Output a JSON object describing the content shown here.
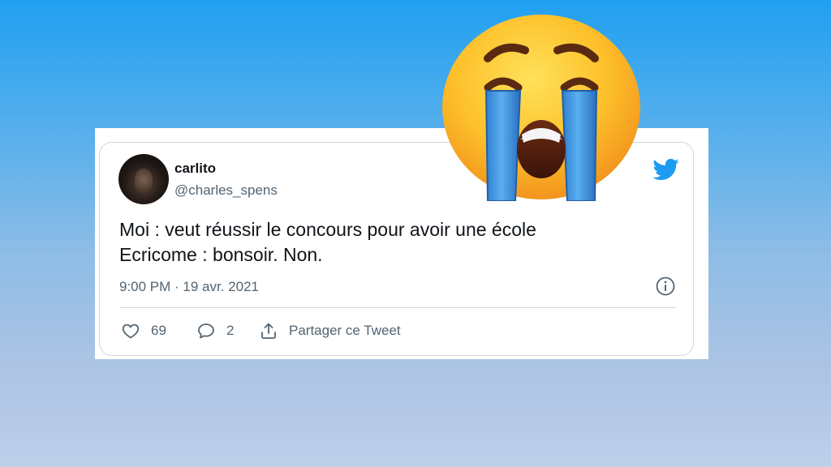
{
  "tweet": {
    "display_name": "carlito",
    "handle": "@charles_spens",
    "text_lines": [
      "Moi : veut réussir le concours pour avoir une école",
      "Ecricome : bonsoir. Non."
    ],
    "timestamp": "9:00 PM · 19 avr. 2021",
    "likes_count": "69",
    "replies_count": "2",
    "share_label": "Partager ce Tweet"
  },
  "icons": {
    "bird": "twitter-bird-icon",
    "info": "info-icon",
    "like": "heart-icon",
    "reply": "speech-bubble-icon",
    "share": "share-upload-icon",
    "emoji": "loudly-crying-face-emoji"
  },
  "colors": {
    "twitter_blue": "#1d9bf0",
    "text_primary": "#0f1419",
    "text_secondary": "#536471",
    "border": "#cfd9de"
  }
}
